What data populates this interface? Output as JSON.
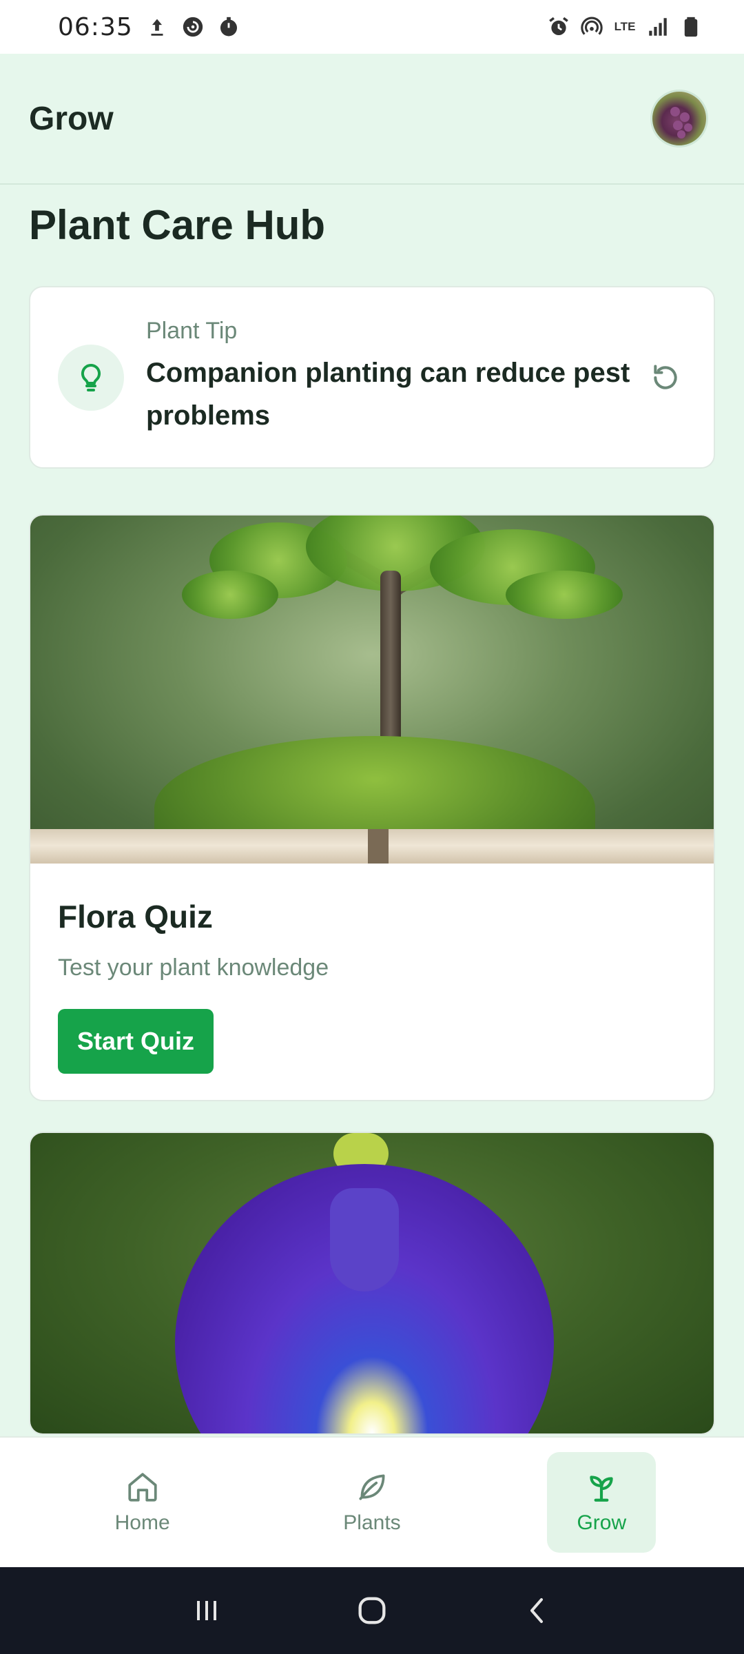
{
  "status_bar": {
    "time": "06:35",
    "left_icons": [
      "upload-icon",
      "sync-icon",
      "timer-icon"
    ],
    "right_icons": [
      "alarm-icon",
      "hotspot-icon",
      "lte-icon",
      "signal-icon",
      "battery-icon"
    ],
    "network": "LTE"
  },
  "app": {
    "title": "Grow",
    "avatar_icon": "user-avatar"
  },
  "page": {
    "title": "Plant Care Hub"
  },
  "tip": {
    "label": "Plant Tip",
    "text": "Companion planting can reduce pest problems",
    "icon": "lightbulb-icon",
    "refresh_icon": "refresh-icon"
  },
  "quiz": {
    "title": "Flora Quiz",
    "subtitle": "Test your plant knowledge",
    "button": "Start Quiz",
    "image": "tree-on-book-image"
  },
  "second_card": {
    "image": "butterfly-pea-flower-image"
  },
  "bottom_nav": {
    "items": [
      {
        "label": "Home",
        "icon": "home-icon",
        "active": false
      },
      {
        "label": "Plants",
        "icon": "leaf-icon",
        "active": false
      },
      {
        "label": "Grow",
        "icon": "sprout-icon",
        "active": true
      }
    ]
  },
  "colors": {
    "accent": "#16a34a",
    "background": "#e6f7ec",
    "muted_text": "#6b8878"
  },
  "system_nav": [
    "recents-icon",
    "home-circle-icon",
    "back-icon"
  ]
}
